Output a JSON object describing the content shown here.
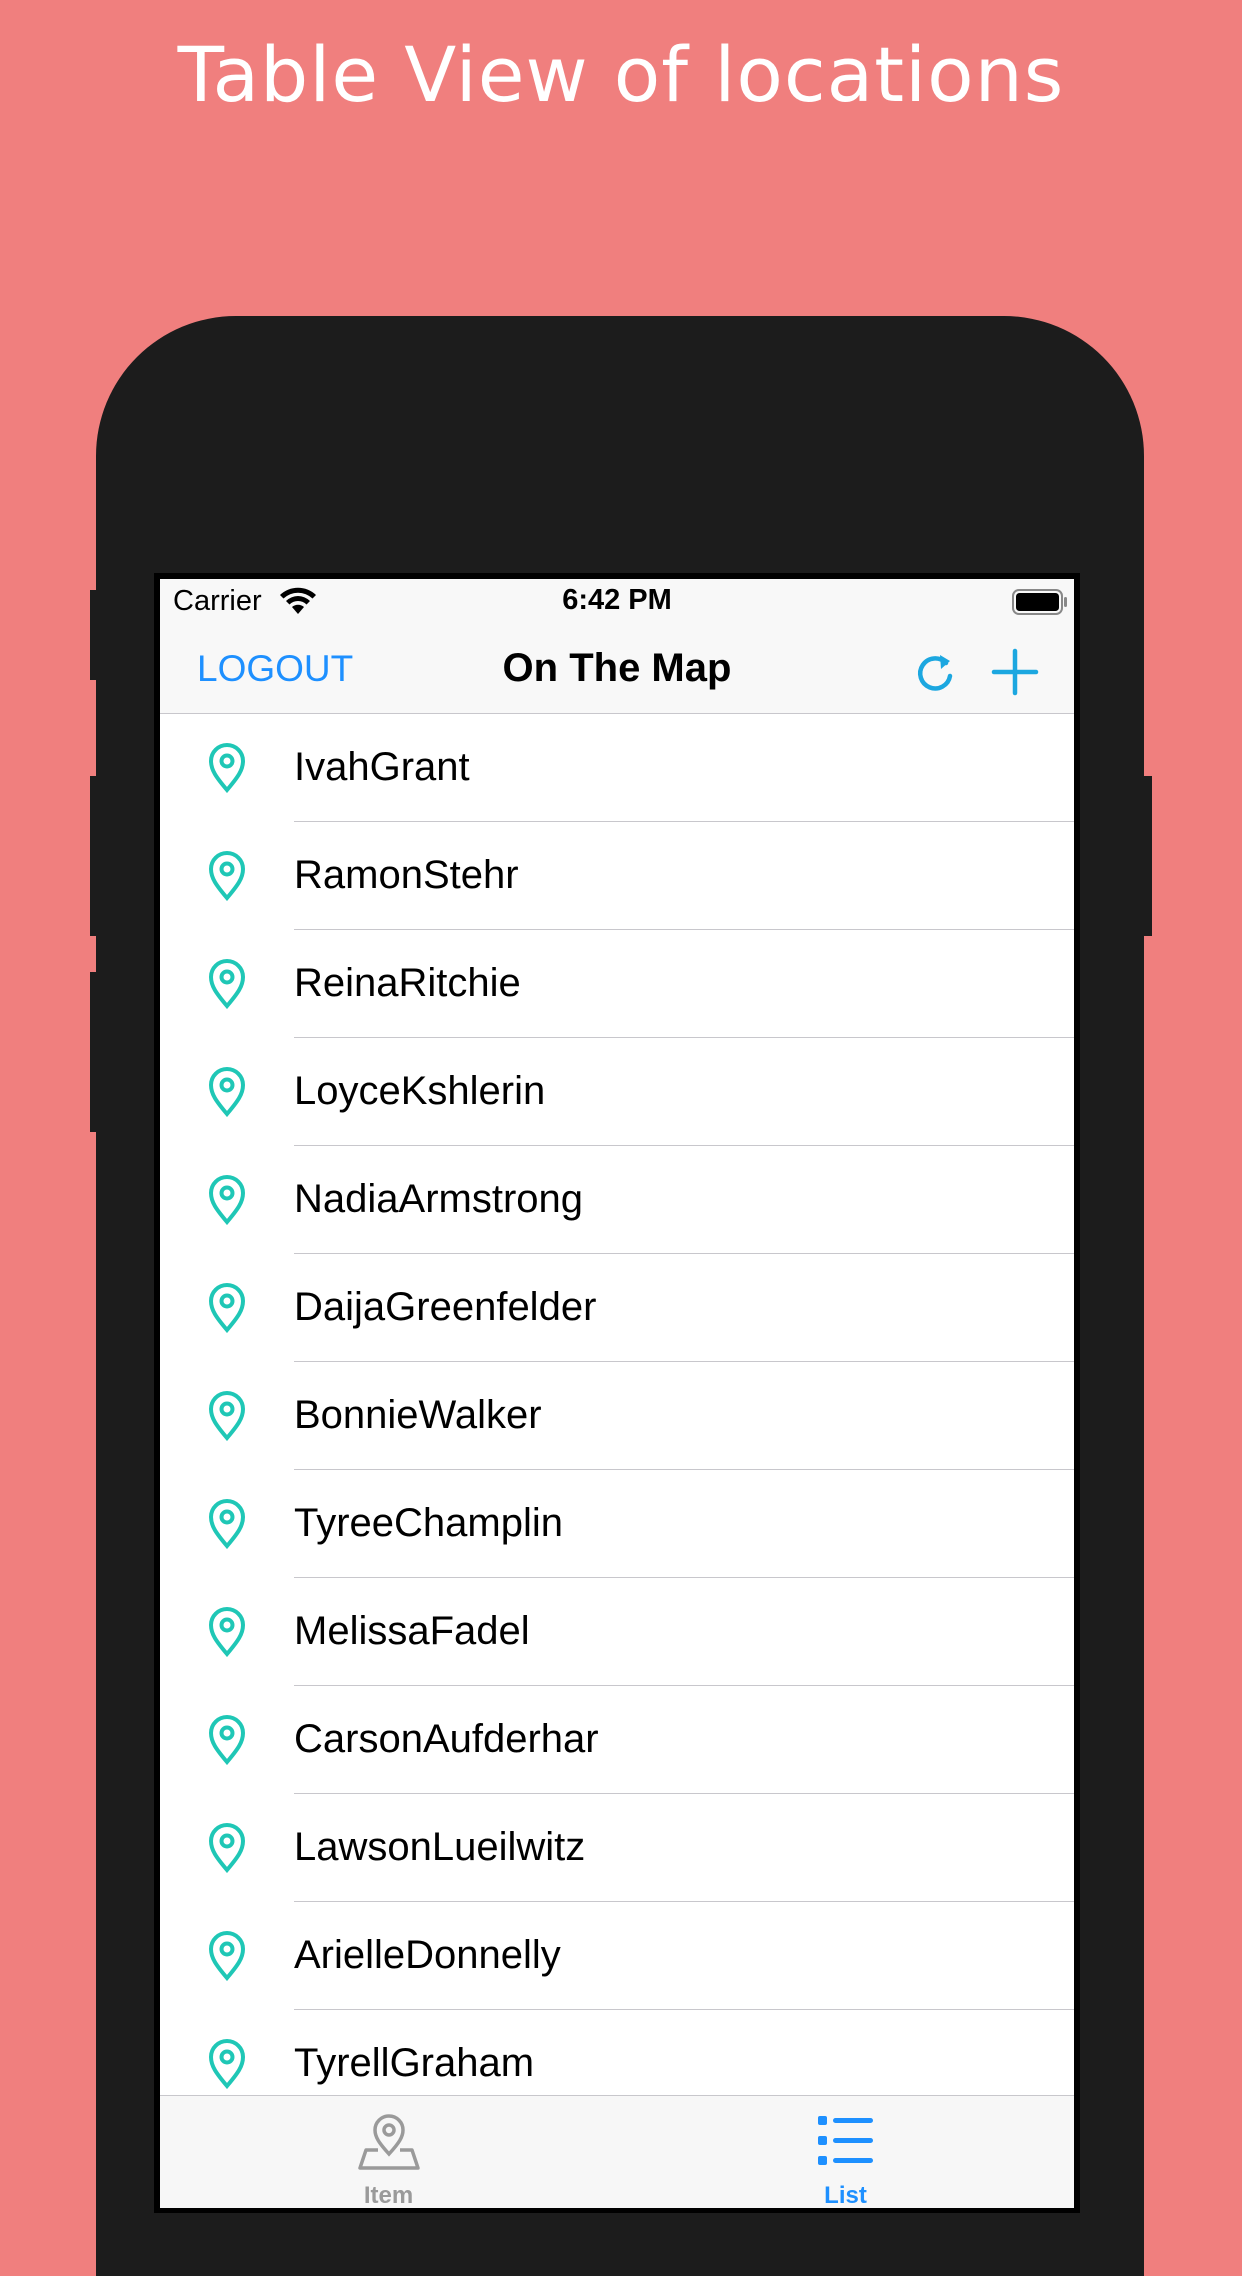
{
  "headline": "Table View of locations",
  "status_bar": {
    "carrier": "Carrier",
    "time": "6:42 PM"
  },
  "nav": {
    "logout_label": "LOGOUT",
    "title": "On The Map",
    "refresh_icon": "refresh-icon",
    "add_icon": "plus-icon"
  },
  "locations": [
    "IvahGrant",
    "RamonStehr",
    "ReinaRitchie",
    "LoyceKshlerin",
    "NadiaArmstrong",
    "DaijaGreenfelder",
    "BonnieWalker",
    "TyreeChamplin",
    "MelissaFadel",
    "CarsonAufderhar",
    "LawsonLueilwitz",
    "ArielleDonnelly",
    "TyrellGraham"
  ],
  "tabs": [
    {
      "label": "Item",
      "icon": "map-pin-icon",
      "selected": false
    },
    {
      "label": "List",
      "icon": "list-icon",
      "selected": true
    }
  ],
  "colors": {
    "background": "#F07F7E",
    "accent": "#1E90FF",
    "pin": "#1FC7B6",
    "tab_inactive": "#9A9A9A"
  }
}
